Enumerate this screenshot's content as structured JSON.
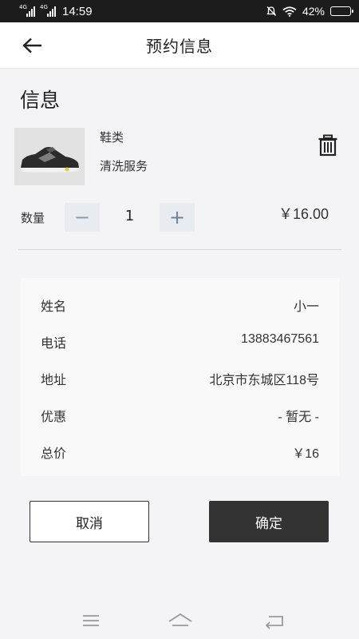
{
  "status_bar": {
    "network_1": "4G",
    "network_2": "4G",
    "time": "14:59",
    "battery": "42%",
    "battery_level": 0.42
  },
  "header": {
    "title": "预约信息",
    "back_icon": "arrow-left-icon"
  },
  "section": {
    "title": "信息"
  },
  "product": {
    "image_icon": "sneaker-image",
    "name": "鞋类",
    "service": "清洗服务",
    "delete_icon": "trash-icon"
  },
  "quantity": {
    "label": "数量",
    "minus": "−",
    "value": "1",
    "plus": "+",
    "price": "￥16.00"
  },
  "info": {
    "rows": [
      {
        "label": "姓名",
        "value": "小一"
      },
      {
        "label": "电话",
        "value": "13883467561"
      },
      {
        "label": "地址",
        "value": "北京市东城区118号"
      },
      {
        "label": "优惠",
        "value": "- 暂无 -"
      },
      {
        "label": "总价",
        "value": "￥16"
      }
    ]
  },
  "actions": {
    "cancel": "取消",
    "confirm": "确定"
  },
  "system_nav": {
    "menu_icon": "menu-icon",
    "home_icon": "home-icon",
    "back_icon": "return-icon"
  }
}
